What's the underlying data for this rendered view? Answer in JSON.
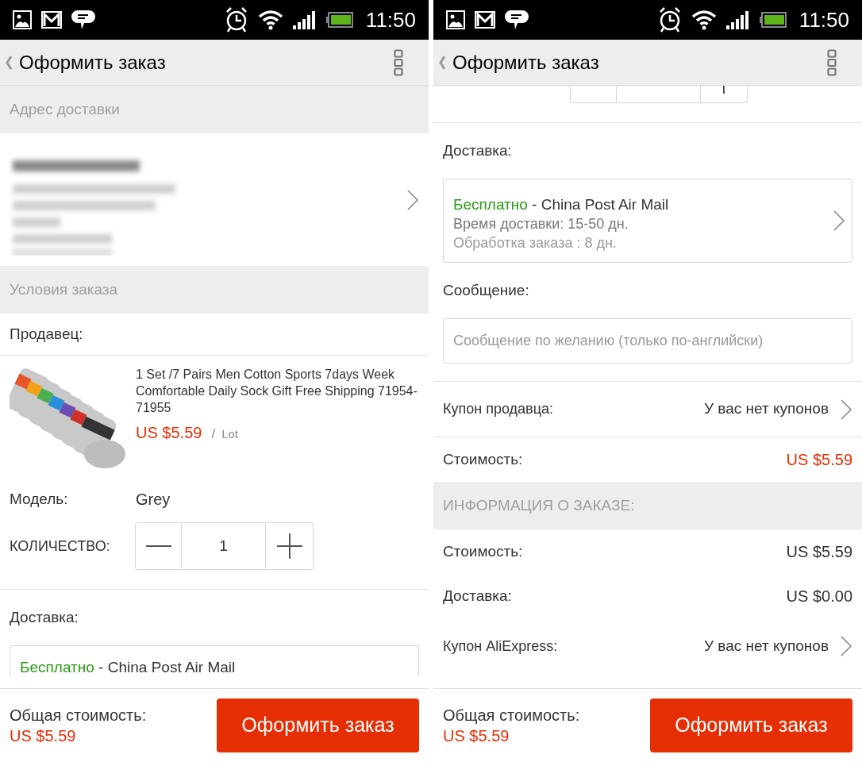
{
  "screens": [
    {
      "status_bar": {
        "time": "11:50"
      },
      "header": {
        "title": "Оформить заказ"
      },
      "sections": [
        {
          "kind": "section_header",
          "text": "Адрес доставки"
        },
        {
          "kind": "address"
        },
        {
          "kind": "section_header",
          "text": "Условия заказа"
        },
        {
          "kind": "label",
          "text": "Продавец:",
          "border": true
        },
        {
          "kind": "product",
          "title": "1 Set /7 Pairs Men Cotton Sports 7days Week Comfortable Daily Sock Gift Free Shipping 71954-71955",
          "price": "US $5.59",
          "separator": "/",
          "unit": "Lot"
        },
        {
          "kind": "field_row",
          "label": "Модель:",
          "value": "Grey"
        },
        {
          "kind": "quantity",
          "label": "КОЛИЧЕСТВО:",
          "value": "1"
        },
        {
          "kind": "label",
          "text": "Доставка:",
          "border": false
        },
        {
          "kind": "shipping_top",
          "price": "Бесплатно",
          "method": "- China Post Air Mail"
        }
      ],
      "footer": {
        "total_label": "Общая стоимость:",
        "total": "US $5.59",
        "button": "Оформить заказ"
      }
    },
    {
      "status_bar": {
        "time": "11:50"
      },
      "header": {
        "title": "Оформить заказ"
      },
      "sections": [
        {
          "kind": "stepper_edge"
        },
        {
          "kind": "label",
          "text": "Доставка:",
          "border": false
        },
        {
          "kind": "shipping",
          "price": "Бесплатно",
          "method": "- China Post Air Mail",
          "time": "Время доставки: 15-50 дн.",
          "processing": "Обработка заказа : 8 дн."
        },
        {
          "kind": "label",
          "text": "Сообщение:",
          "border": false
        },
        {
          "kind": "message",
          "placeholder": "Сообщение по желанию (только по-английски)"
        },
        {
          "kind": "link_row",
          "label": "Купон продавца:",
          "value": "У вас нет купонов"
        },
        {
          "kind": "price_row",
          "label": "Стоимость:",
          "value": "US $5.59",
          "emphasis": true
        },
        {
          "kind": "section_header",
          "text": "ИНФОРМАЦИЯ О ЗАКАЗЕ:"
        },
        {
          "kind": "price_row",
          "label": "Стоимость:",
          "value": "US $5.59",
          "emphasis": false
        },
        {
          "kind": "price_row",
          "label": "Доставка:",
          "value": "US $0.00",
          "emphasis": false
        },
        {
          "kind": "link_row",
          "label": "Купон AliExpress:",
          "value": "У вас нет купонов"
        }
      ],
      "footer": {
        "total_label": "Общая стоимость:",
        "total": "US $5.59",
        "button": "Оформить заказ"
      }
    }
  ]
}
